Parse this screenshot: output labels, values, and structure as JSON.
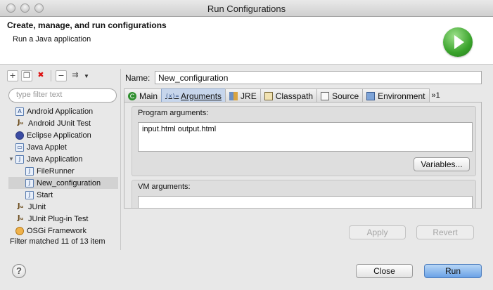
{
  "window": {
    "title": "Run Configurations"
  },
  "header": {
    "title": "Create, manage, and run configurations",
    "subtitle": "Run a Java application",
    "logo_icon": "run-icon"
  },
  "toolbar": {
    "icons": [
      "new-launch-configuration-icon",
      "duplicate-icon",
      "delete-icon",
      "collapse-all-icon",
      "filter-icon",
      "dropdown-arrow-icon"
    ]
  },
  "filter": {
    "placeholder": "type filter text"
  },
  "tree": [
    {
      "label": "Android Application",
      "icon": "android-application-icon",
      "level": 0
    },
    {
      "label": "Android JUnit Test",
      "icon": "junit-icon",
      "level": 0
    },
    {
      "label": "Eclipse Application",
      "icon": "eclipse-icon",
      "level": 0
    },
    {
      "label": "Java Applet",
      "icon": "java-applet-icon",
      "level": 0
    },
    {
      "label": "Java Application",
      "icon": "java-application-icon",
      "level": 0,
      "expanded": true
    },
    {
      "label": "FileRunner",
      "icon": "java-application-icon",
      "level": 1
    },
    {
      "label": "New_configuration",
      "icon": "java-application-icon",
      "level": 1,
      "selected": true
    },
    {
      "label": "Start",
      "icon": "java-application-icon",
      "level": 1
    },
    {
      "label": "JUnit",
      "icon": "junit-icon",
      "level": 0
    },
    {
      "label": "JUnit Plug-in Test",
      "icon": "junit-icon",
      "level": 0
    },
    {
      "label": "OSGi Framework",
      "icon": "osgi-icon",
      "level": 0
    }
  ],
  "filter_status": "Filter matched 11 of 13 item",
  "name": {
    "label": "Name:",
    "value": "New_configuration"
  },
  "tabs": [
    {
      "label": "Main",
      "icon": "main-icon"
    },
    {
      "label": "Arguments",
      "icon": "arguments-icon",
      "active": true
    },
    {
      "label": "JRE",
      "icon": "jre-icon"
    },
    {
      "label": "Classpath",
      "icon": "classpath-icon"
    },
    {
      "label": "Source",
      "icon": "source-icon"
    },
    {
      "label": "Environment",
      "icon": "environment-icon"
    },
    {
      "label": "»1",
      "icon": ""
    }
  ],
  "arguments": {
    "program_label": "Program arguments:",
    "program_value": "input.html output.html",
    "variables_button": "Variables...",
    "vm_label": "VM arguments:",
    "vm_value": ""
  },
  "buttons": {
    "apply": "Apply",
    "revert": "Revert",
    "close": "Close",
    "run": "Run",
    "help": "?"
  }
}
